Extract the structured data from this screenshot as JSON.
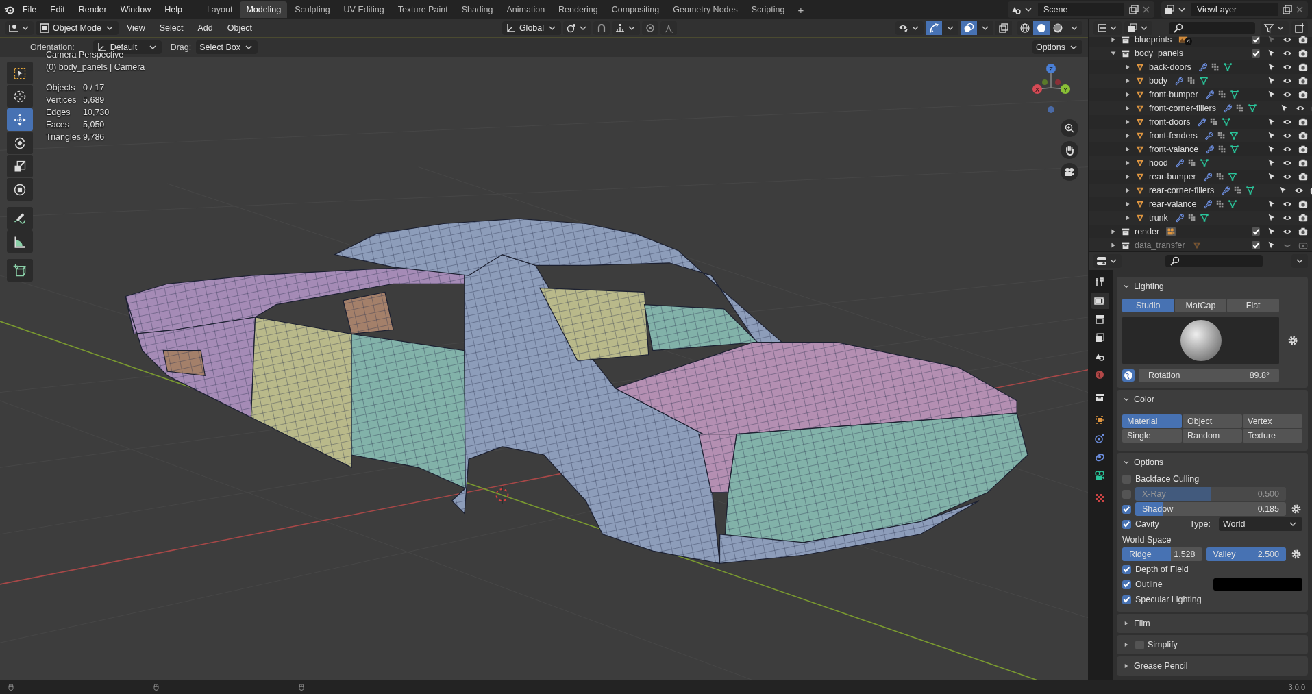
{
  "menu": [
    "File",
    "Edit",
    "Render",
    "Window",
    "Help"
  ],
  "workspaces": [
    {
      "label": "Layout",
      "selected": false
    },
    {
      "label": "Modeling",
      "selected": true
    },
    {
      "label": "Sculpting",
      "selected": false
    },
    {
      "label": "UV Editing",
      "selected": false
    },
    {
      "label": "Texture Paint",
      "selected": false
    },
    {
      "label": "Shading",
      "selected": false
    },
    {
      "label": "Animation",
      "selected": false
    },
    {
      "label": "Rendering",
      "selected": false
    },
    {
      "label": "Compositing",
      "selected": false
    },
    {
      "label": "Geometry Nodes",
      "selected": false
    },
    {
      "label": "Scripting",
      "selected": false
    }
  ],
  "add_workspace": "+",
  "scene": "Scene",
  "view_layer": "ViewLayer",
  "viewport": {
    "mode": "Object Mode",
    "menus": [
      "View",
      "Select",
      "Add",
      "Object"
    ],
    "orientation": "Global",
    "toggles": [
      {
        "kind": "gizmo",
        "on": true
      },
      {
        "kind": "overlay",
        "on": true
      },
      {
        "kind": "xray",
        "on": false
      }
    ],
    "shading": [
      {
        "kind": "wireframe",
        "selected": false
      },
      {
        "kind": "solid",
        "selected": true
      },
      {
        "kind": "material",
        "selected": false
      }
    ],
    "tool_settings": {
      "orientation_label": "Orientation:",
      "orientation": "Default",
      "drag_label": "Drag:",
      "drag": "Select Box",
      "options": "Options"
    },
    "view_name": "Camera Perspective",
    "context": "(0) body_panels | Camera",
    "stats": [
      {
        "label": "Objects",
        "value": "0 / 17"
      },
      {
        "label": "Vertices",
        "value": "5,689"
      },
      {
        "label": "Edges",
        "value": "10,730"
      },
      {
        "label": "Faces",
        "value": "5,050"
      },
      {
        "label": "Triangles",
        "value": "9,786"
      }
    ],
    "tools": [
      {
        "kind": "select-box",
        "selected": false
      },
      {
        "kind": "cursor",
        "selected": false
      },
      {
        "kind": "move",
        "selected": true
      },
      {
        "kind": "rotate",
        "selected": false
      },
      {
        "kind": "scale",
        "selected": false
      },
      {
        "kind": "transform",
        "selected": false
      },
      {
        "kind": "annotate",
        "selected": false
      },
      {
        "kind": "measure",
        "selected": false
      },
      {
        "kind": "add-cube",
        "selected": false
      }
    ],
    "axes": [
      "X",
      "Y",
      "Z"
    ]
  },
  "outliner": {
    "items": [
      {
        "name": "blueprints",
        "kind": "collection",
        "expanded": false,
        "checked": true,
        "selectable": false,
        "visible": true,
        "renderable": true,
        "disabled": false,
        "badge": {
          "kind": "image",
          "count": "4"
        }
      },
      {
        "name": "body_panels",
        "kind": "collection",
        "expanded": true,
        "checked": true,
        "selectable": true,
        "visible": true,
        "renderable": true,
        "disabled": false,
        "children": [
          {
            "name": "back-doors",
            "kind": "mesh"
          },
          {
            "name": "body",
            "kind": "mesh"
          },
          {
            "name": "front-bumper",
            "kind": "mesh"
          },
          {
            "name": "front-corner-fillers",
            "kind": "mesh"
          },
          {
            "name": "front-doors",
            "kind": "mesh"
          },
          {
            "name": "front-fenders",
            "kind": "mesh"
          },
          {
            "name": "front-valance",
            "kind": "mesh"
          },
          {
            "name": "hood",
            "kind": "mesh"
          },
          {
            "name": "rear-bumper",
            "kind": "mesh"
          },
          {
            "name": "rear-corner-fillers",
            "kind": "mesh"
          },
          {
            "name": "rear-valance",
            "kind": "mesh"
          },
          {
            "name": "trunk",
            "kind": "mesh"
          }
        ]
      },
      {
        "name": "render",
        "kind": "collection",
        "expanded": false,
        "checked": true,
        "selectable": true,
        "visible": true,
        "renderable": true,
        "disabled": false,
        "badge": {
          "kind": "camera"
        }
      },
      {
        "name": "data_transfer",
        "kind": "collection",
        "expanded": false,
        "checked": true,
        "selectable": true,
        "visible": false,
        "renderable": false,
        "disabled": true,
        "badge": {
          "kind": "mesh"
        }
      }
    ]
  },
  "properties": {
    "tabs": [
      {
        "kind": "tool",
        "selected": false
      },
      {
        "kind": "render",
        "selected": true
      },
      {
        "kind": "output",
        "selected": false
      },
      {
        "kind": "view-layer",
        "selected": false
      },
      {
        "kind": "scene",
        "selected": false
      },
      {
        "kind": "world",
        "selected": false
      },
      {
        "kind": "collection",
        "selected": false
      },
      {
        "kind": "object",
        "selected": false
      },
      {
        "kind": "physics",
        "selected": false
      },
      {
        "kind": "constraints",
        "selected": false
      },
      {
        "kind": "camera-data",
        "selected": false
      },
      {
        "kind": "texture",
        "selected": false
      }
    ],
    "lighting": {
      "title": "Lighting",
      "expanded": true,
      "modes": [
        {
          "label": "Studio",
          "selected": true
        },
        {
          "label": "MatCap",
          "selected": false
        },
        {
          "label": "Flat",
          "selected": false
        }
      ],
      "rotation_label": "Rotation",
      "rotation": "89.8°"
    },
    "color": {
      "title": "Color",
      "expanded": true,
      "options": [
        {
          "label": "Material",
          "selected": true
        },
        {
          "label": "Object",
          "selected": false
        },
        {
          "label": "Vertex",
          "selected": false
        },
        {
          "label": "Single",
          "selected": false
        },
        {
          "label": "Random",
          "selected": false
        },
        {
          "label": "Texture",
          "selected": false
        }
      ]
    },
    "options": {
      "title": "Options",
      "expanded": true,
      "rows": [
        {
          "kind": "checkbox",
          "label": "Backface Culling",
          "checked": false
        },
        {
          "kind": "slider",
          "label": "X-Ray",
          "checked": false,
          "level": 0.5,
          "value": "0.500",
          "disabled": true,
          "gear": false
        },
        {
          "kind": "slider",
          "label": "Shadow",
          "checked": true,
          "level": 0.185,
          "value": "0.185",
          "disabled": false,
          "gear": true
        },
        {
          "kind": "dropdown",
          "label": "Cavity",
          "checked": true,
          "field_label": "Type:",
          "value": "World"
        },
        {
          "kind": "heading",
          "label": "World Space"
        },
        {
          "kind": "pair",
          "fields": [
            {
              "label": "Ridge",
              "value": "1.528",
              "level": 0.611
            },
            {
              "label": "Valley",
              "value": "2.500",
              "level": 1
            }
          ]
        },
        {
          "kind": "checkbox",
          "label": "Depth of Field",
          "checked": true
        },
        {
          "kind": "color",
          "label": "Outline",
          "checked": true,
          "color": "#000000"
        },
        {
          "kind": "checkbox",
          "label": "Specular Lighting",
          "checked": true
        }
      ]
    },
    "collapsed": [
      {
        "title": "Film"
      },
      {
        "title": "Simplify",
        "checked": false
      },
      {
        "title": "Grease Pencil"
      }
    ]
  },
  "version": "3.0.0"
}
